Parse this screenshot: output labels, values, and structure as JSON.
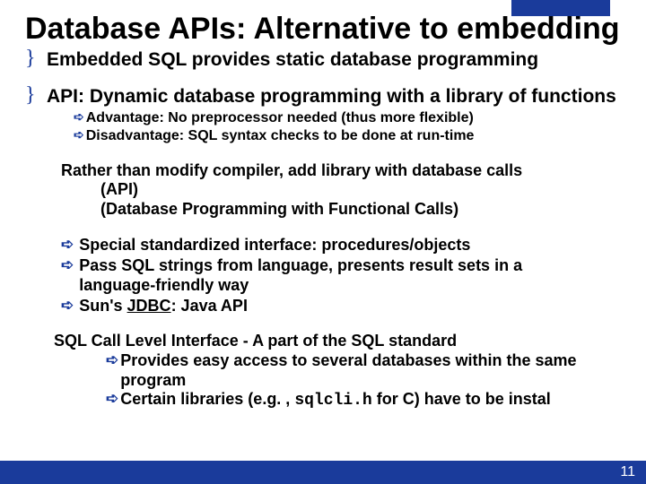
{
  "accentColor": "#1a3b9b",
  "title": "Database APIs: Alternative to embedding",
  "bullets": {
    "b1": "Embedded SQL provides static database programming",
    "b2": "API: Dynamic database programming with a library of functions",
    "adv": "Advantage: No preprocessor needed (thus more flexible)",
    "dis": "Disadvantage: SQL syntax checks to be done at run-time",
    "para1_l1": "Rather than modify compiler, add library with database calls",
    "para1_l2": "(API)",
    "para1_l3": "(Database Programming with Functional Calls)",
    "sp1": "Special standardized interface: procedures/objects",
    "sp2_l1": "Pass SQL strings from language, presents result sets in a",
    "sp2_l2": "language-friendly way",
    "sp3_pre": "Sun's ",
    "sp3_jdbc": "JDBC",
    "sp3_post": ": Java API",
    "sql_title": "SQL Call Level Interface - A part of the SQL standard",
    "sql_s1_l1": "Provides easy access to several databases within the same",
    "sql_s1_l2": "program",
    "sql_s2_pre": "Certain libraries (e.g. , ",
    "sql_s2_code": "sqlcli.h",
    "sql_s2_post": " for C)  have to be instal"
  },
  "pageNumber": "11"
}
